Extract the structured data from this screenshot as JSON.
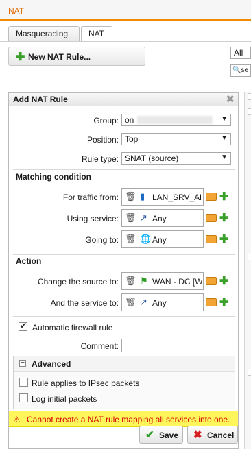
{
  "app": {
    "title": "NAT"
  },
  "tabs": [
    {
      "label": "Masquerading"
    },
    {
      "label": "NAT"
    }
  ],
  "toolbar": {
    "new_rule_label": "New NAT Rule...",
    "filter_value": "All",
    "search_placeholder": "se"
  },
  "dialog": {
    "title": "Add NAT Rule",
    "group": {
      "label": "Group:",
      "value": "on"
    },
    "position": {
      "label": "Position:",
      "value": "Top"
    },
    "rule_type": {
      "label": "Rule type:",
      "value": "SNAT (source)"
    },
    "matching_condition": {
      "title": "Matching condition",
      "traffic_from": {
        "label": "For traffic from:",
        "value": "LAN_SRV_Al"
      },
      "using_service": {
        "label": "Using service:",
        "value": "Any"
      },
      "going_to": {
        "label": "Going to:",
        "value": "Any"
      }
    },
    "action": {
      "title": "Action",
      "change_source": {
        "label": "Change the source to:",
        "value": "WAN - DC [W"
      },
      "and_service": {
        "label": "And the service to:",
        "value": "Any"
      }
    },
    "auto_firewall": {
      "label": "Automatic firewall rule",
      "checked": true
    },
    "comment": {
      "label": "Comment:",
      "value": ""
    },
    "advanced": {
      "title": "Advanced",
      "ipsec": {
        "label": "Rule applies to IPsec packets",
        "checked": false
      },
      "log": {
        "label": "Log initial packets",
        "checked": false
      }
    },
    "warning": "Cannot create a NAT rule mapping all services into one.",
    "save_label": "Save",
    "cancel_label": "Cancel"
  },
  "colors": {
    "accent": "#f08a00",
    "warning_bg": "#fff65c",
    "warning_text": "#d40000",
    "add_green": "#3aa02a"
  }
}
